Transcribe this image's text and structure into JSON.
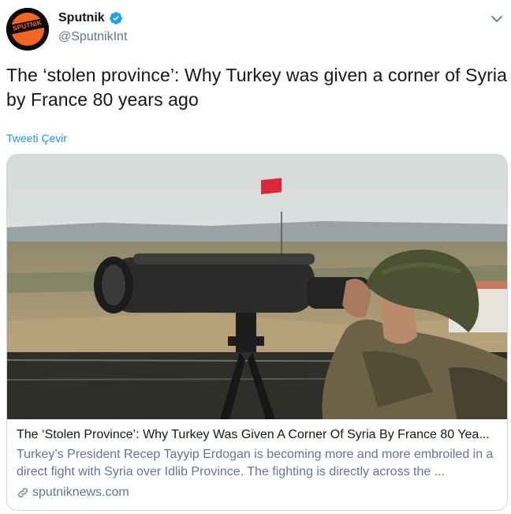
{
  "author": {
    "display_name": "Sputnik",
    "handle": "@SputnikInt",
    "avatar_text": "SPUTNIK",
    "verified": true
  },
  "tweet": {
    "text": "The ‘stolen province’: Why Turkey was given a corner of Syria by France 80 years ago",
    "translate_label": "Tweeti Çevir"
  },
  "card": {
    "title": "The ‘Stolen Province’: Why Turkey Was Given A Corner Of Syria By France 80 Yea...",
    "description": "Turkey’s President Recep Tayyip Erdogan is becoming more and more embroiled in a direct fight with Syria over Idlib Province. The fighting is directly across the ...",
    "domain": "sputniknews.com"
  },
  "colors": {
    "link_blue": "#1b95e0",
    "secondary_text": "#657786",
    "sputnik_orange": "#f26522"
  },
  "icons": {
    "verified": "verified-badge-icon",
    "menu": "chevron-down-icon",
    "link": "link-icon"
  }
}
